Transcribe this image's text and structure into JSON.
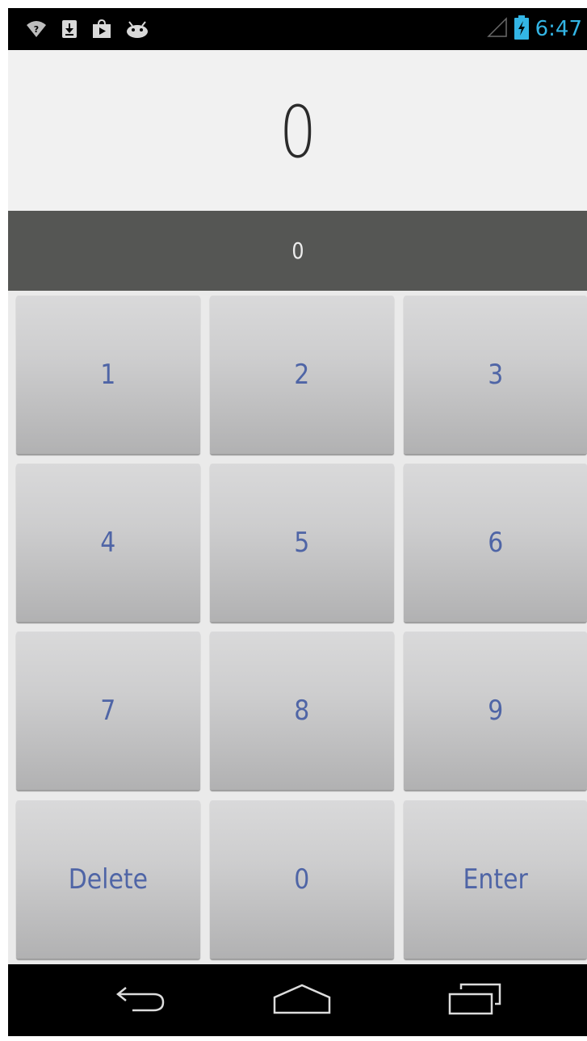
{
  "status_bar": {
    "time": "6:47",
    "icons_left": [
      "wifi-question-icon",
      "download-icon",
      "play-store-icon",
      "android-icon"
    ],
    "icons_right": [
      "signal-icon",
      "battery-charging-icon"
    ],
    "accent_color": "#33b5e5"
  },
  "display": {
    "main_value": "0",
    "secondary_value": "0"
  },
  "keypad": {
    "keys": [
      {
        "label": "1"
      },
      {
        "label": "2"
      },
      {
        "label": "3"
      },
      {
        "label": "4"
      },
      {
        "label": "5"
      },
      {
        "label": "6"
      },
      {
        "label": "7"
      },
      {
        "label": "8"
      },
      {
        "label": "9"
      },
      {
        "label": "Delete"
      },
      {
        "label": "0"
      },
      {
        "label": "Enter"
      }
    ],
    "label_color": "#4f65a6"
  },
  "nav_bar": {
    "buttons": [
      "back-icon",
      "home-icon",
      "recent-apps-icon"
    ]
  }
}
